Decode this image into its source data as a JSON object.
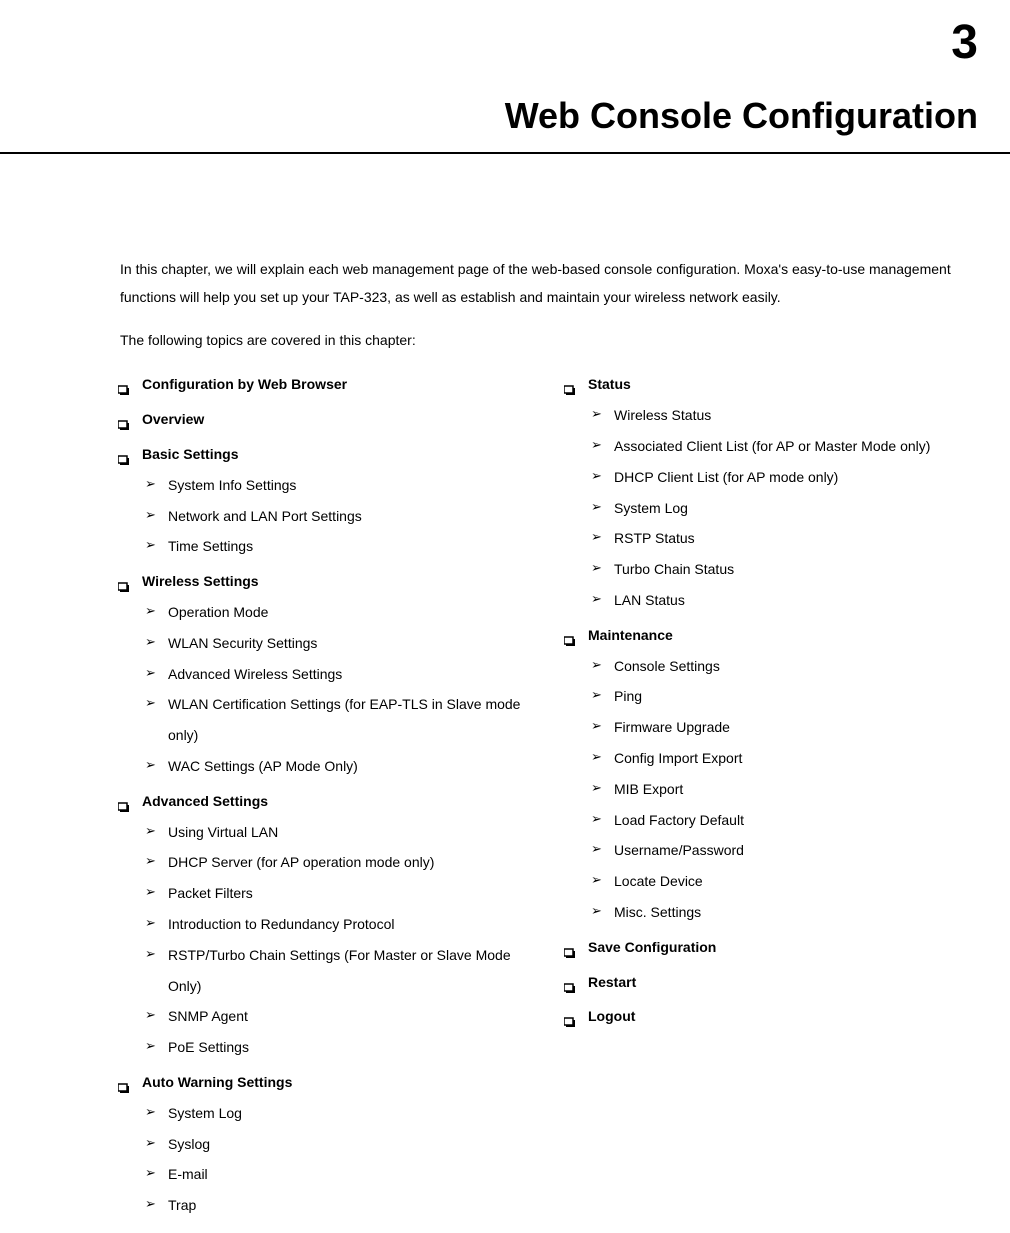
{
  "chapter": {
    "number": "3",
    "title": "Web Console Configuration"
  },
  "intro": "In this chapter, we will explain each web management page of the web-based console configuration. Moxa's easy-to-use management functions will help you set up your TAP-323, as well as establish and maintain your wireless network easily.",
  "intro_lead": "The following topics are covered in this chapter:",
  "left_column": [
    {
      "title": "Configuration by Web Browser",
      "items": []
    },
    {
      "title": "Overview",
      "items": []
    },
    {
      "title": "Basic Settings",
      "items": [
        "System Info Settings",
        "Network and LAN Port Settings",
        "Time Settings"
      ]
    },
    {
      "title": "Wireless Settings",
      "items": [
        "Operation Mode",
        "WLAN Security Settings",
        "Advanced Wireless Settings",
        "WLAN Certification Settings (for EAP-TLS in Slave mode only)",
        "WAC Settings (AP Mode Only)"
      ]
    },
    {
      "title": "Advanced Settings",
      "items": [
        "Using Virtual LAN",
        "DHCP Server (for AP operation mode only)",
        "Packet Filters",
        "Introduction to Redundancy Protocol",
        "RSTP/Turbo Chain Settings (For Master or Slave Mode Only)",
        "SNMP Agent",
        "PoE Settings"
      ]
    },
    {
      "title": "Auto Warning Settings",
      "items": [
        "System Log",
        "Syslog",
        "E-mail",
        "Trap"
      ]
    }
  ],
  "right_column": [
    {
      "title": "Status",
      "items": [
        "Wireless Status",
        "Associated Client List (for AP or Master Mode only)",
        "DHCP Client List (for AP mode only)",
        "System Log",
        "RSTP Status",
        "Turbo Chain Status",
        "LAN Status"
      ]
    },
    {
      "title": "Maintenance",
      "items": [
        "Console Settings",
        "Ping",
        "Firmware Upgrade",
        "Config Import Export",
        "MIB Export",
        "Load Factory Default",
        "Username/Password",
        "Locate Device",
        "Misc. Settings"
      ]
    },
    {
      "title": "Save Configuration",
      "items": []
    },
    {
      "title": "Restart",
      "items": []
    },
    {
      "title": "Logout",
      "items": []
    }
  ]
}
